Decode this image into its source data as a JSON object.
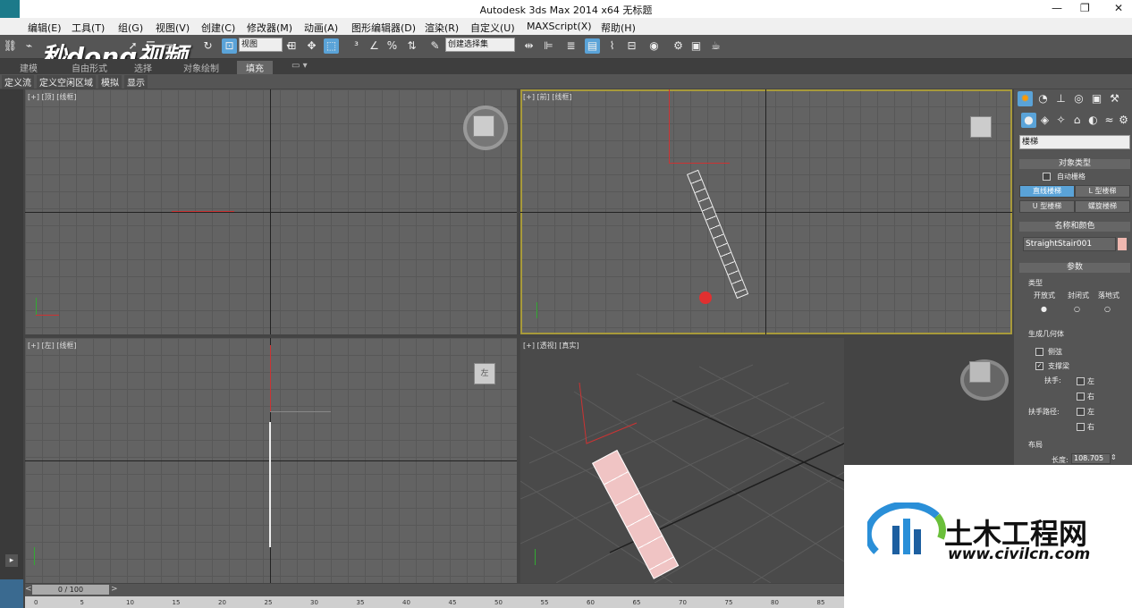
{
  "window": {
    "title": "Autodesk 3ds Max  2014 x64     无标题",
    "minimize": "—",
    "maximize": "❐",
    "close": "✕"
  },
  "menu": [
    "编辑(E)",
    "工具(T)",
    "组(G)",
    "视图(V)",
    "创建(C)",
    "修改器(M)",
    "动画(A)",
    "图形编辑器(D)",
    "渲染(R)",
    "自定义(U)",
    "MAXScript(X)",
    "帮助(H)"
  ],
  "toolbar": {
    "view_select": "视图",
    "selection_set": "创建选择集"
  },
  "ribbon": {
    "tabs": [
      "建模",
      "自由形式",
      "选择",
      "对象绘制",
      "填充"
    ],
    "active": "填充",
    "row2": [
      "定义流",
      "定义空闲区域",
      "模拟",
      "显示"
    ]
  },
  "viewports": {
    "top": {
      "label": "[+] [顶] [线框]"
    },
    "front": {
      "label": "[+] [前] [线框]"
    },
    "left": {
      "label": "[+] [左] [线框]",
      "cube_face": "左"
    },
    "perspective": {
      "label": "[+] [透视] [真实]"
    }
  },
  "command_panel": {
    "category": "楼梯",
    "object_type_header": "对象类型",
    "auto_grid": "自动栅格",
    "buttons": [
      "直线楼梯",
      "L 型楼梯",
      "U 型楼梯",
      "螺旋楼梯"
    ],
    "active_button": "直线楼梯",
    "name_color_header": "名称和颜色",
    "name": "StraightStair001",
    "object_color": "#f0b8b0",
    "params_header": "参数",
    "type_group": "类型",
    "types": [
      "开放式",
      "封闭式",
      "落地式"
    ],
    "selected_type": "开放式",
    "gen_geo_group": "生成几何体",
    "stringers": "侧弦",
    "carriage": "支撑梁",
    "carriage_checked": true,
    "handrail": "扶手:",
    "railpath": "扶手路径:",
    "left": "左",
    "right": "右",
    "layout_group": "布局",
    "length_label": "长度:",
    "length_value": "108.705"
  },
  "timeline": {
    "frame": "0 / 100",
    "ticks": [
      "0",
      "5",
      "10",
      "15",
      "20",
      "25",
      "30",
      "35",
      "40",
      "45",
      "50",
      "55",
      "60",
      "65",
      "70",
      "75",
      "80",
      "85"
    ]
  },
  "watermarks": {
    "topleft": "秒dong视频",
    "brand": "土木工程网",
    "url": "www.civilcn.com"
  },
  "colors": {
    "active_button": "#5aa3d8",
    "viewport_bg": "#636363",
    "stair": "#f0c4c4",
    "active_border": "#a89a3a"
  }
}
